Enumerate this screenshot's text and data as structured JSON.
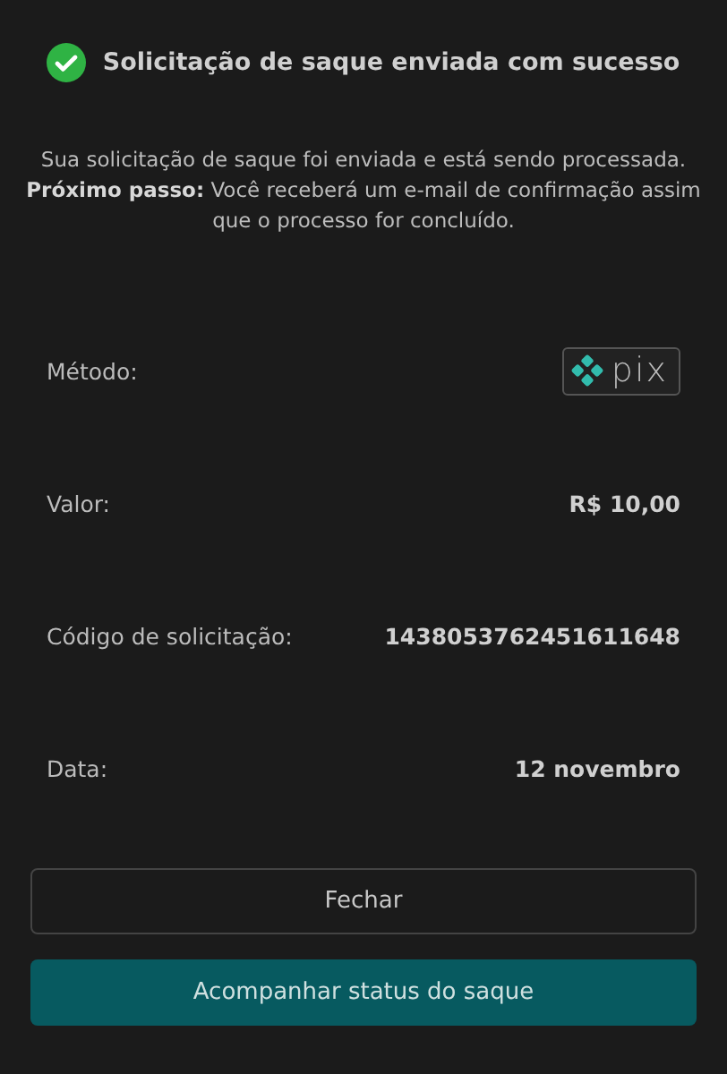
{
  "header": {
    "title": "Solicitação de saque enviada com sucesso"
  },
  "message": {
    "line": "Sua solicitação de saque foi enviada e está sendo processada.",
    "next_step": "**Próximo passo:** Você receberá um e-mail de confirmação assim que o processo for concluído."
  },
  "details": [
    {
      "label": "Método:",
      "kind": "logo",
      "value": "pix"
    },
    {
      "label": "Valor:",
      "kind": "text",
      "value": "R$ 10,00"
    },
    {
      "label": "Código de solicitação:",
      "kind": "text",
      "value": "1438053762451611648"
    },
    {
      "label": "Data:",
      "kind": "text",
      "value": "12 novembro"
    }
  ],
  "buttons": [
    {
      "label": "Fechar",
      "kind": "outline"
    },
    {
      "label": "Acompanhar status do saque",
      "kind": "primary"
    }
  ]
}
